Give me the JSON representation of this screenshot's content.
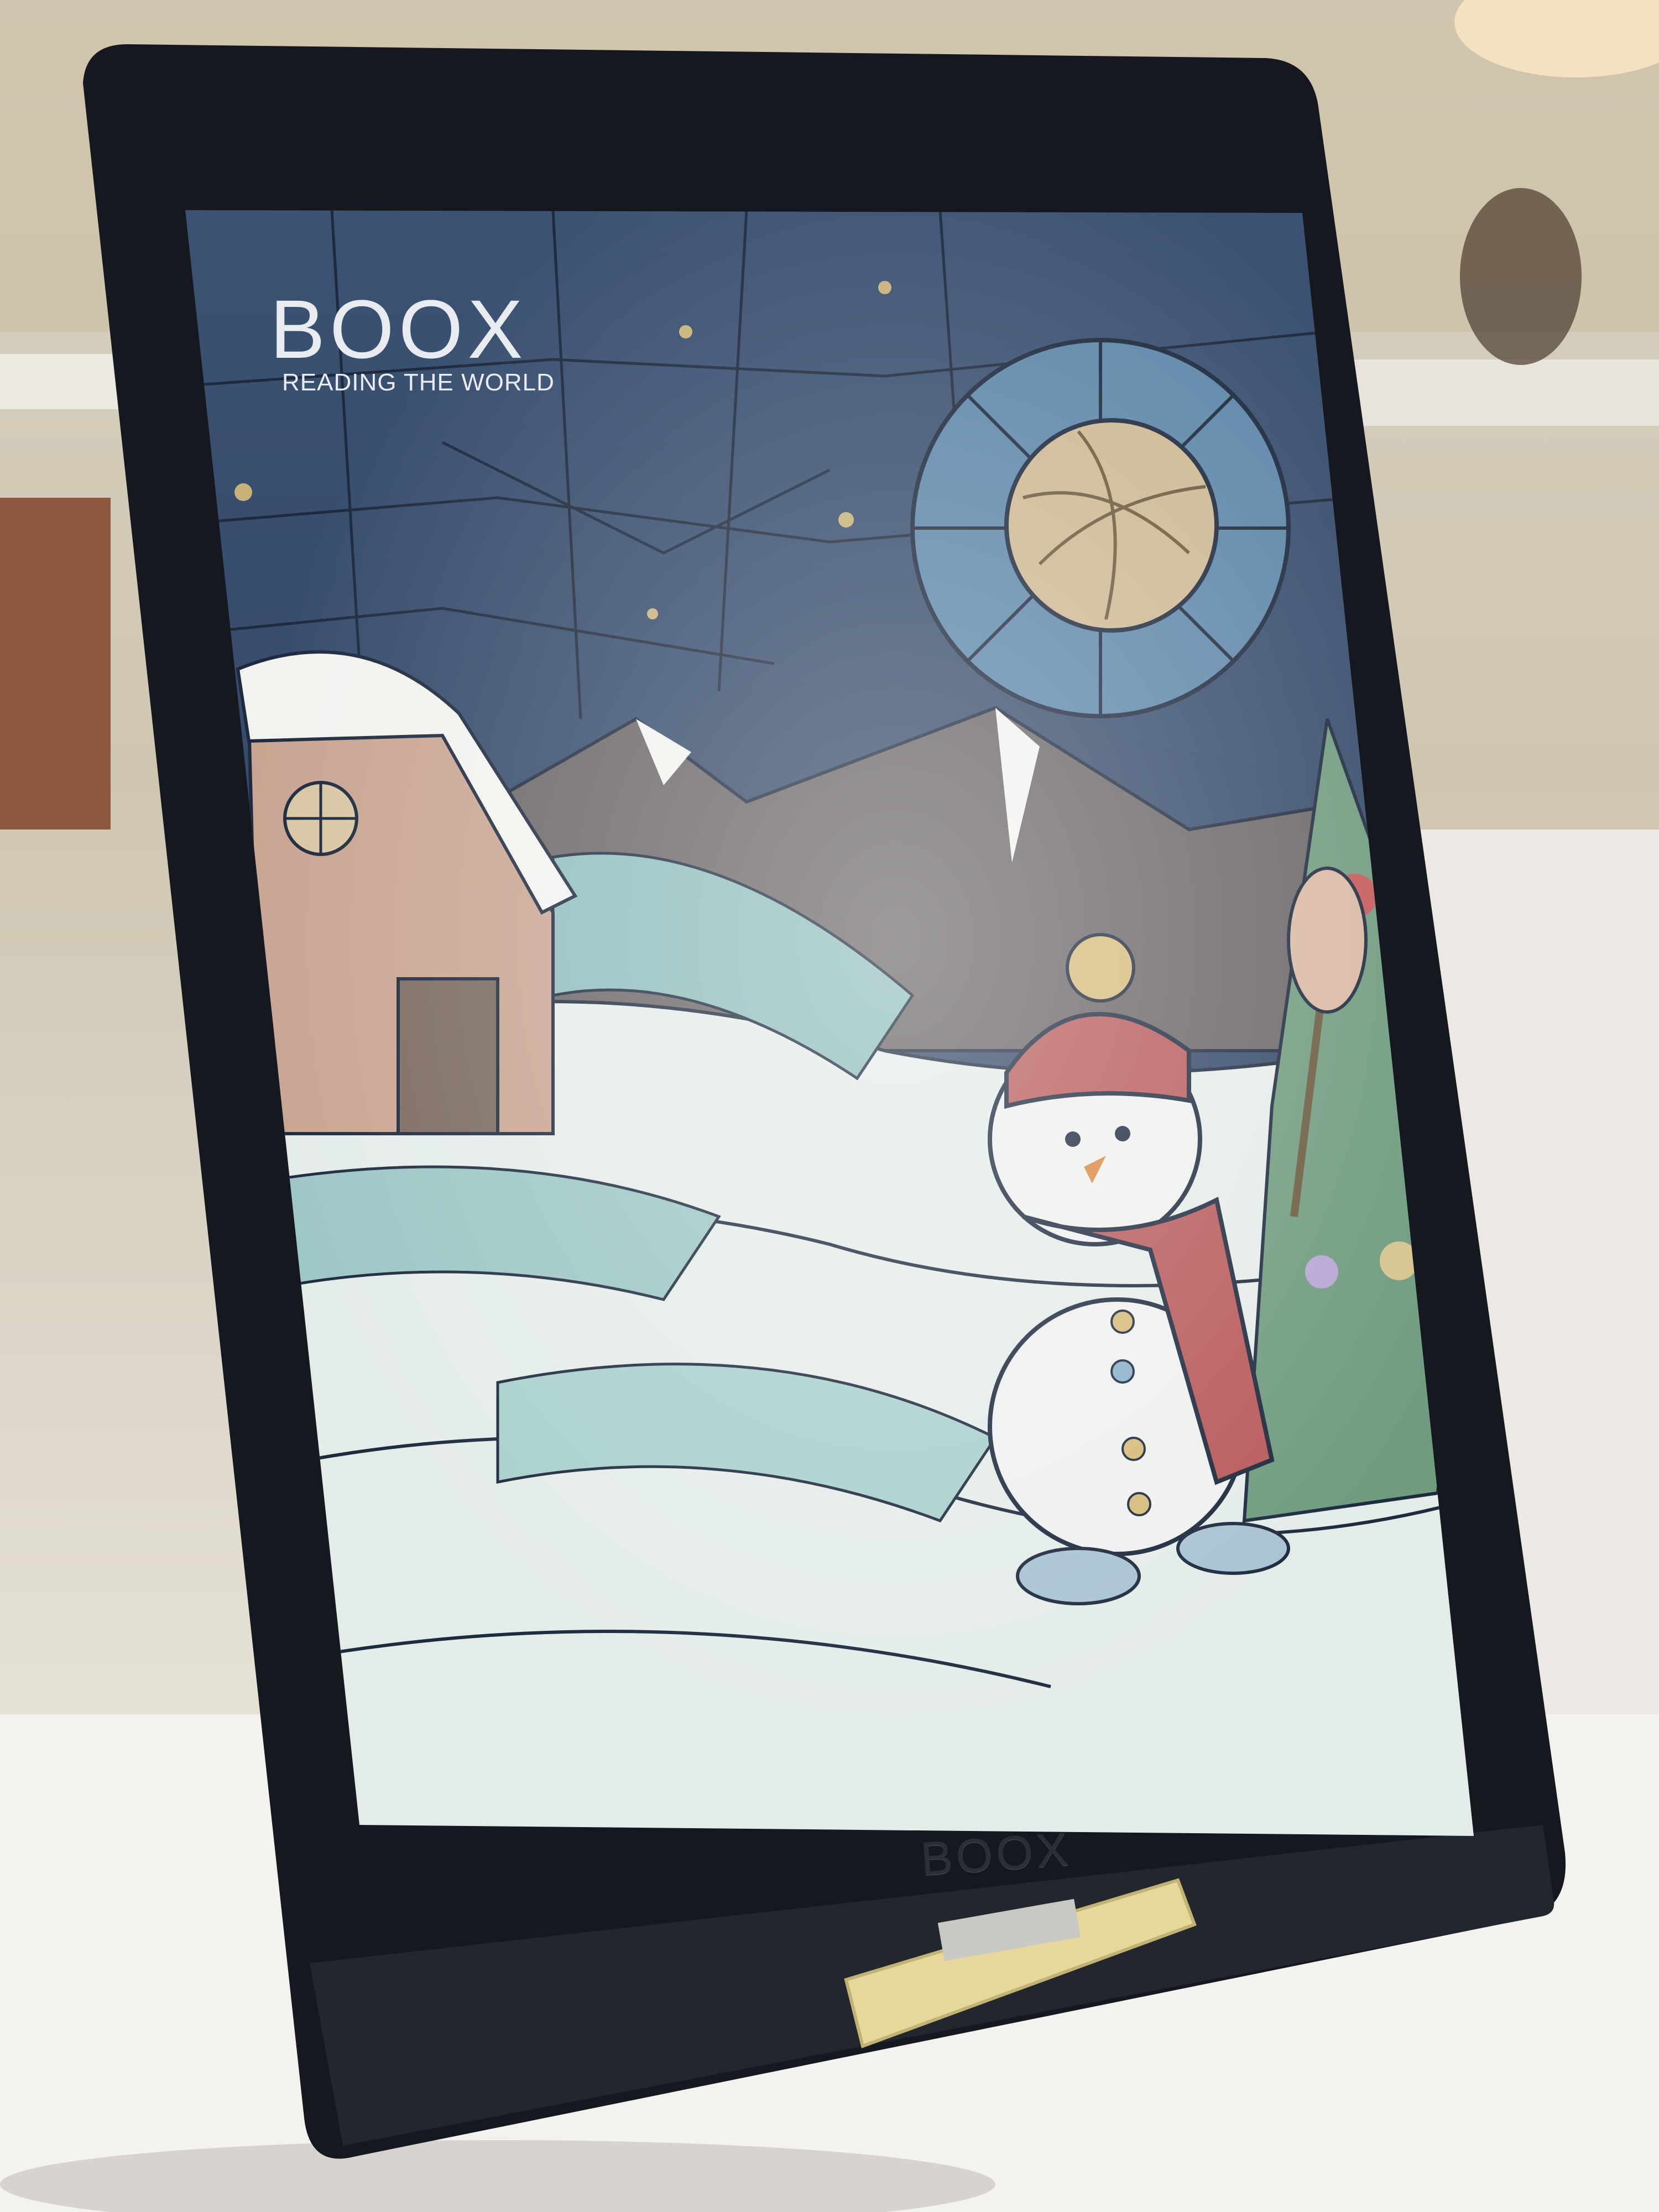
{
  "screen": {
    "brand": "BOOX",
    "tagline": "READING THE WORLD"
  },
  "device": {
    "bezel_logo": "BOOX"
  },
  "colors": {
    "bezel": "#15191f",
    "sky": "#2f4466",
    "moon": "#cdb892",
    "snow": "#e4ece9",
    "scarf": "#b85a5a",
    "stand": "#e7d79a"
  }
}
